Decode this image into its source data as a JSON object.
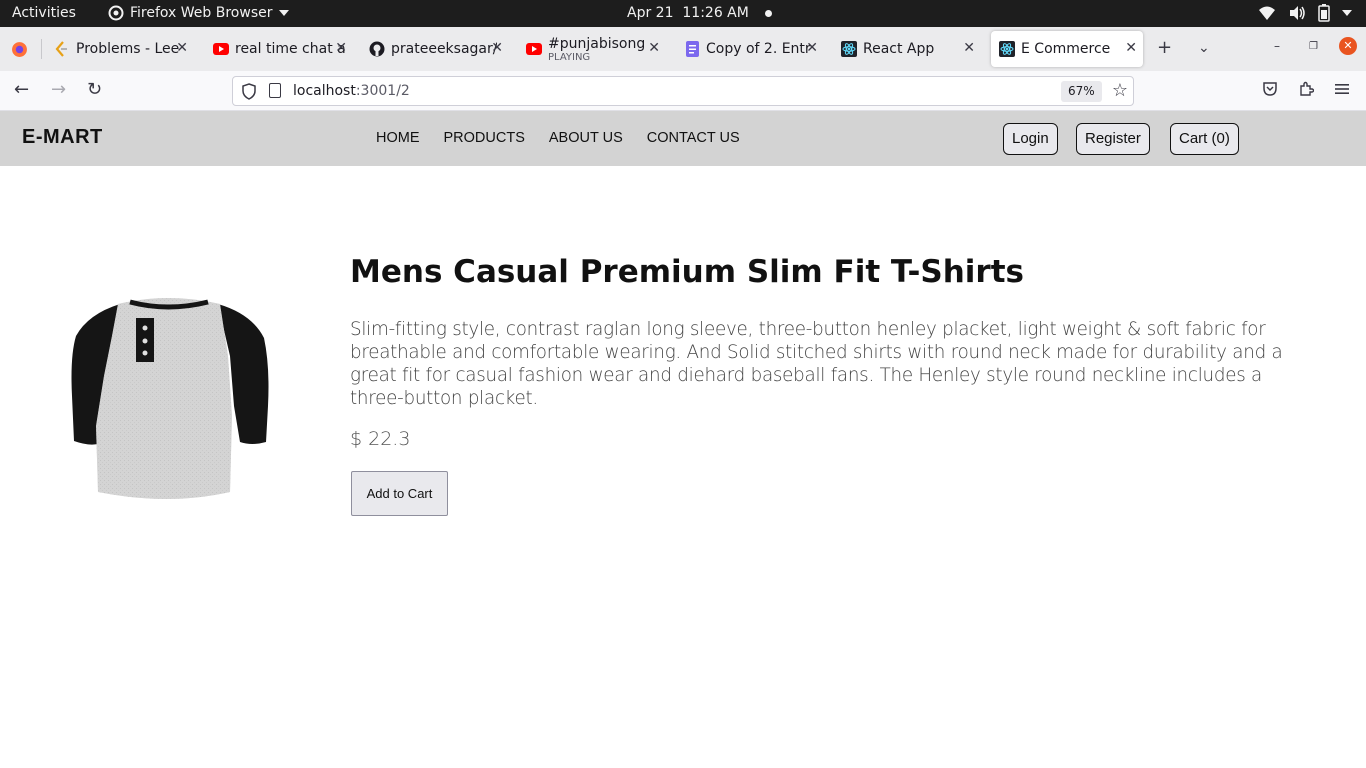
{
  "system": {
    "activities": "Activities",
    "app_menu": "Firefox Web Browser",
    "date": "Apr 21",
    "time": "11:26 AM"
  },
  "tabs": [
    {
      "label": "Problems - Lee",
      "icon": "leetcode-icon"
    },
    {
      "label": "real time chat a",
      "icon": "youtube-icon"
    },
    {
      "label": "prateeeksagar/",
      "icon": "github-icon"
    },
    {
      "label": "#punjabisong",
      "sub": "PLAYING",
      "icon": "youtube-icon"
    },
    {
      "label": "Copy of 2. Entr",
      "icon": "docs-icon"
    },
    {
      "label": "React App",
      "icon": "react-icon"
    },
    {
      "label": "E Commerce",
      "icon": "react-icon",
      "active": true
    }
  ],
  "url": {
    "host": "localhost",
    "path": ":3001/2",
    "zoom": "67%"
  },
  "site": {
    "brand": "E-MART",
    "nav": [
      "HOME",
      "PRODUCTS",
      "ABOUT US",
      "CONTACT US"
    ],
    "login": "Login",
    "register": "Register",
    "cart": "Cart (0)"
  },
  "product": {
    "title": "Mens Casual Premium Slim Fit T-Shirts",
    "description": "Slim-fitting style, contrast raglan long sleeve, three-button henley placket, light weight & soft fabric for breathable and comfortable wearing. And Solid stitched shirts with round neck made for durability and a great fit for casual fashion wear and diehard baseball fans. The Henley style round neckline includes a three-button placket.",
    "price": "$ 22.3",
    "add_to_cart": "Add to Cart"
  },
  "colors": {
    "header_bg": "#d3d3d3",
    "close_button": "#e95420"
  }
}
